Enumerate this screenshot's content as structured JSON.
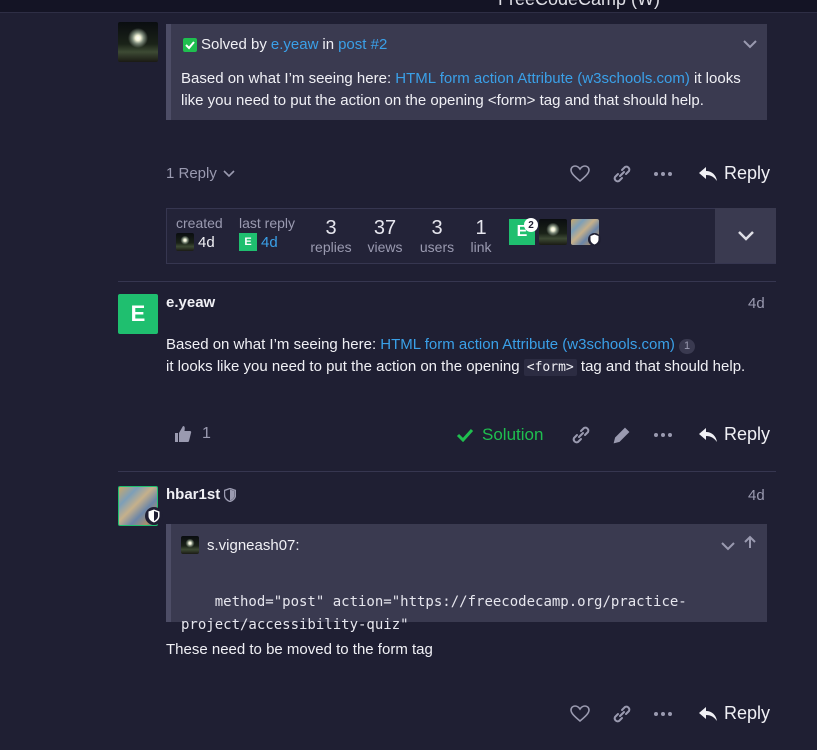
{
  "topbar": {
    "title": "FreeCodeCamp (W)"
  },
  "post1": {
    "solution_quote": {
      "prefix": "Solved by",
      "author_link": "e.yeaw",
      "in_text": "in",
      "post_link": "post #2",
      "text_before": "Based on what I’m seeing here:",
      "link_text": "HTML form action Attribute (w3schools.com)",
      "text_after_line1": "it looks",
      "text_line2": "like you need to put the action on the opening <form> tag and that should help."
    },
    "replies_toggle": "1 Reply",
    "reply_label": "Reply"
  },
  "topic_map": {
    "created_label": "created",
    "created_value": "4d",
    "last_reply_label": "last reply",
    "last_reply_value": "4d",
    "stats": [
      {
        "num": "3",
        "label": "replies"
      },
      {
        "num": "37",
        "label": "views"
      },
      {
        "num": "3",
        "label": "users"
      },
      {
        "num": "1",
        "label": "link"
      }
    ],
    "participant_badge_count": "2"
  },
  "post2": {
    "avatar_letter": "E",
    "username": "e.yeaw",
    "time": "4d",
    "text_before": "Based on what I’m seeing here:",
    "link_text": "HTML form action Attribute (w3schools.com)",
    "link_count": "1",
    "text_line2_before": "it looks like you need to put the action on the opening",
    "code": "<form>",
    "text_line2_after": "tag and that should help.",
    "like_count": "1",
    "solution_label": "Solution",
    "reply_label": "Reply"
  },
  "post3": {
    "username": "hbar1st",
    "time": "4d",
    "quote_author": "s.vigneash07:",
    "quote_code_line1": "method=\"post\" action=\"https://freecodecamp.org/practice-",
    "quote_code_line2": "project/accessibility-quiz\"",
    "body": "These need to be moved to the form tag",
    "reply_label": "Reply"
  },
  "colors": {
    "background": "#1f1f33",
    "link": "#3aa0e8",
    "solution_green": "#1fbf4f",
    "avatar_green": "#1fbf6f"
  }
}
